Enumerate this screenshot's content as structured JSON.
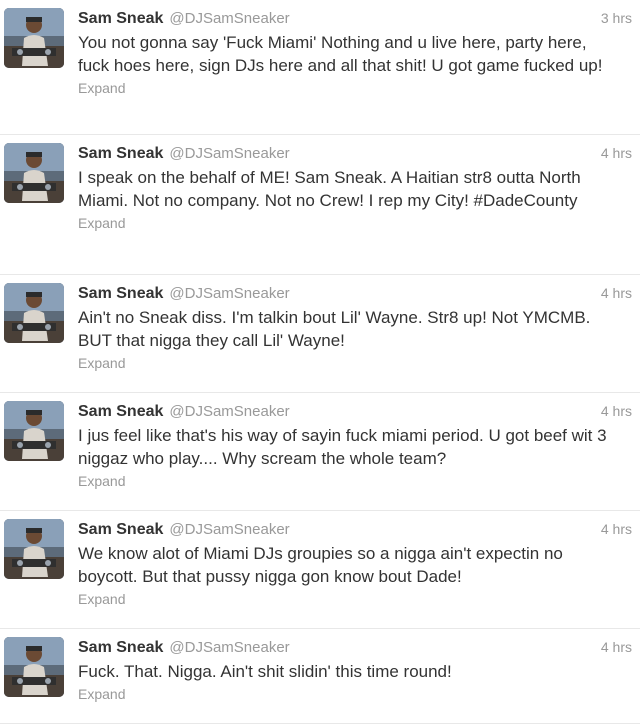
{
  "tweets": [
    {
      "name": "Sam Sneak",
      "handle": "@DJSamSneaker",
      "time": "3 hrs",
      "text": "You not gonna say 'Fuck Miami' Nothing and u live here, party here, fuck hoes here, sign DJs here and all that shit! U got game fucked up!",
      "expand": "Expand"
    },
    {
      "name": "Sam Sneak",
      "handle": "@DJSamSneaker",
      "time": "4 hrs",
      "text": "I speak on the behalf of ME! Sam Sneak. A Haitian str8 outta North Miami. Not no company. Not no Crew! I rep my City! #DadeCounty",
      "expand": "Expand"
    },
    {
      "name": "Sam Sneak",
      "handle": "@DJSamSneaker",
      "time": "4 hrs",
      "text": "Ain't no Sneak diss. I'm talkin bout Lil' Wayne. Str8 up! Not YMCMB. BUT that nigga they call Lil' Wayne!",
      "expand": "Expand"
    },
    {
      "name": "Sam Sneak",
      "handle": "@DJSamSneaker",
      "time": "4 hrs",
      "text": "I jus feel like that's his way of sayin fuck miami period. U got beef wit 3 niggaz who play.... Why scream the whole team?",
      "expand": "Expand"
    },
    {
      "name": "Sam Sneak",
      "handle": "@DJSamSneaker",
      "time": "4 hrs",
      "text": "We know alot of Miami DJs groupies so a nigga ain't expectin no boycott. But that pussy nigga gon know bout Dade!",
      "expand": "Expand"
    },
    {
      "name": "Sam Sneak",
      "handle": "@DJSamSneaker",
      "time": "4 hrs",
      "text": "Fuck. That. Nigga. Ain't shit slidin' this time round!",
      "expand": "Expand"
    }
  ],
  "colors": {
    "name": "#333333",
    "meta": "#999999",
    "divider": "#e8e8e8"
  }
}
